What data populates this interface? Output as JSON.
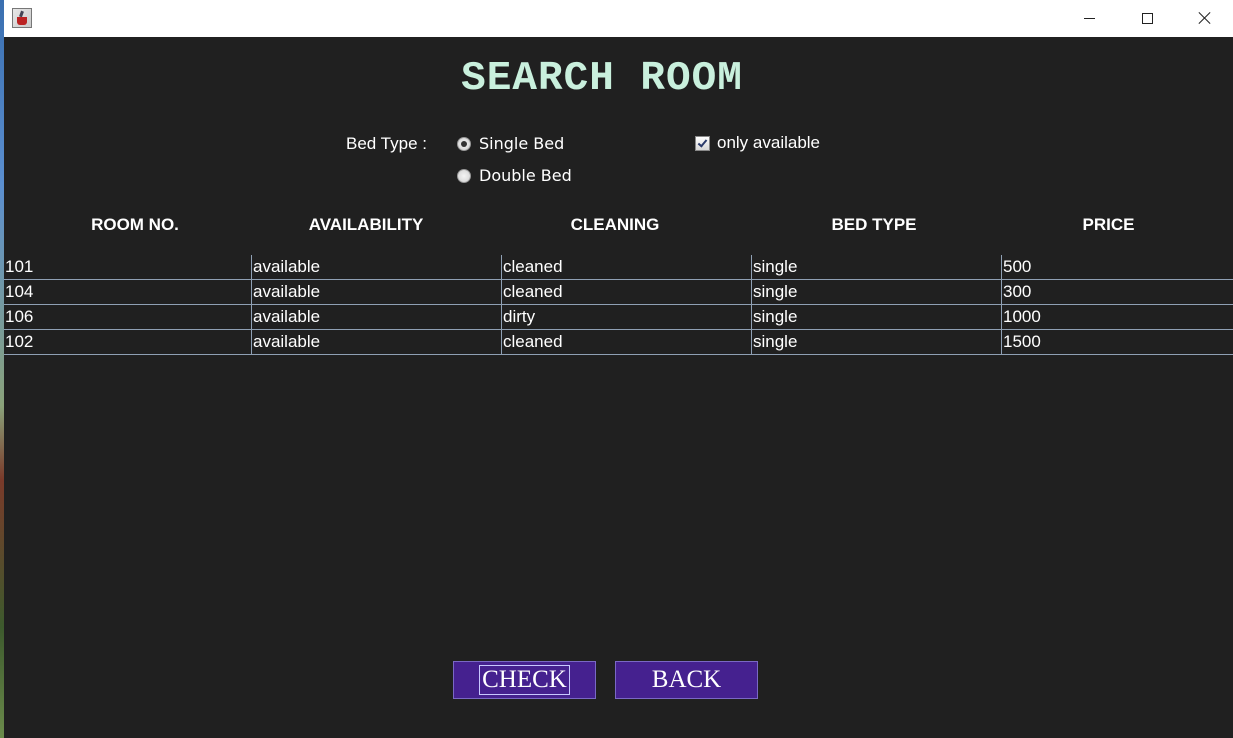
{
  "window": {
    "title": "",
    "controls": {
      "minimize": "minimize-icon",
      "maximize": "maximize-icon",
      "close": "close-icon"
    }
  },
  "page_title": "SEARCH ROOM",
  "filters": {
    "bed_type_label": "Bed Type :",
    "options": [
      {
        "label": "Single Bed",
        "selected": true
      },
      {
        "label": "Double Bed",
        "selected": false
      }
    ],
    "only_available": {
      "label": "only available",
      "checked": true
    }
  },
  "table": {
    "headers": [
      "ROOM NO.",
      "AVAILABILITY",
      "CLEANING",
      "BED TYPE",
      "PRICE"
    ],
    "rows": [
      [
        "101",
        "available",
        "cleaned",
        "single",
        "500"
      ],
      [
        "104",
        "available",
        "cleaned",
        "single",
        "300"
      ],
      [
        "106",
        "available",
        "dirty",
        "single",
        "1000"
      ],
      [
        "102",
        "available",
        "cleaned",
        "single",
        "1500"
      ]
    ]
  },
  "buttons": {
    "check": "CHECK",
    "back": "BACK"
  },
  "colors": {
    "background": "#202020",
    "title": "#c9f0dd",
    "button": "#45218f",
    "grid": "#8fa0b4"
  }
}
